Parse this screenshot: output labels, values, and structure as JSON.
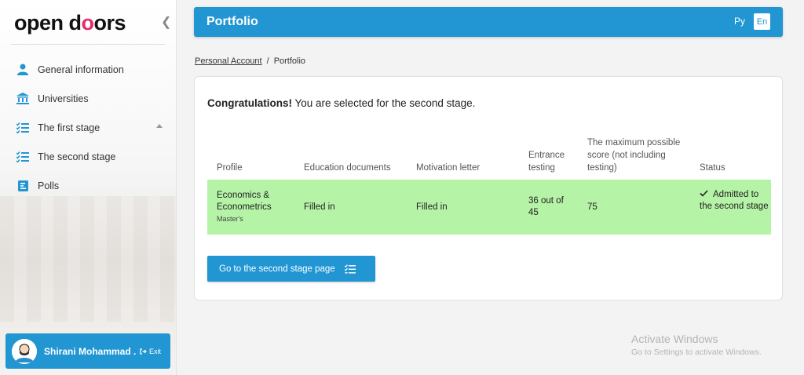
{
  "sidebar": {
    "logo": {
      "part1": "open d",
      "o1": "o",
      "o2": "o",
      "part2": "rs"
    },
    "items": [
      {
        "label": "General information",
        "icon": "person-icon"
      },
      {
        "label": "Universities",
        "icon": "bank-icon"
      },
      {
        "label": "The first stage",
        "icon": "checklist-icon"
      },
      {
        "label": "The second stage",
        "icon": "checklist-icon"
      },
      {
        "label": "Polls",
        "icon": "poll-icon"
      }
    ],
    "user": {
      "name": "Shirani Mohammad ...",
      "exit_label": "Exit"
    }
  },
  "header": {
    "title": "Portfolio",
    "lang_ru": "Ру",
    "lang_en": "En"
  },
  "breadcrumb": {
    "home": "Personal Account",
    "separator": "/",
    "current": "Portfolio"
  },
  "main": {
    "congrats_bold": "Congratulations!",
    "congrats_text": " You are selected for the second stage.",
    "columns": [
      "Profile",
      "Education documents",
      "Motivation letter",
      "Entrance testing",
      "The maximum possible score (not including testing)",
      "Status"
    ],
    "row": {
      "profile": "Economics & Econometrics",
      "profile_sub": "Master's",
      "education_documents": "Filled in",
      "motivation_letter": "Filled in",
      "entrance_testing": "36 out of 45",
      "max_score": "75",
      "status": "Admitted to the second stage"
    },
    "button_label": "Go to the second stage page"
  },
  "watermark": {
    "line1": "Activate Windows",
    "line2": "Go to Settings to activate Windows."
  },
  "colors": {
    "accent": "#2196d3",
    "success_row": "#b5f3a7",
    "logo_pink": "#e8296c"
  }
}
